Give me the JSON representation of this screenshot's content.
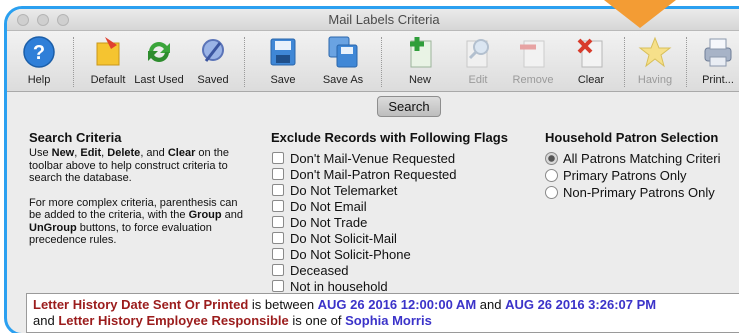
{
  "window": {
    "title": "Mail Labels Criteria"
  },
  "toolbar": {
    "help": "Help",
    "default": "Default",
    "last_used": "Last Used",
    "saved": "Saved",
    "save": "Save",
    "save_as": "Save As",
    "new": "New",
    "edit": "Edit",
    "remove": "Remove",
    "clear": "Clear",
    "having": "Having",
    "print": "Print..."
  },
  "search_button": "Search",
  "search_criteria": {
    "heading": "Search Criteria",
    "p1_a": "Use ",
    "p1_new": "New",
    "p1_b": ", ",
    "p1_edit": "Edit",
    "p1_c": ", ",
    "p1_delete": "Delete",
    "p1_d": ", and ",
    "p1_clear": "Clear",
    "p1_e": " on the toolbar above to help construct criteria to search the database.",
    "p2_a": "For more complex criteria, parenthesis can be added to the criteria, with the ",
    "p2_group": "Group",
    "p2_b": " and ",
    "p2_ungroup": "UnGroup",
    "p2_c": " buttons, to force evaluation precedence rules."
  },
  "exclude": {
    "heading": "Exclude Records with Following Flags",
    "flags": [
      "Don't Mail-Venue Requested",
      "Don't Mail-Patron Requested",
      "Do Not Telemarket",
      "Do Not Email",
      "Do Not Trade",
      "Do Not Solicit-Mail",
      "Do Not Solicit-Phone",
      "Deceased",
      "Not in household"
    ]
  },
  "household": {
    "heading": "Household Patron Selection",
    "options": [
      "All Patrons Matching Criteri",
      "Primary Patrons Only",
      "Non-Primary Patrons Only"
    ],
    "selected_index": 0
  },
  "criteria_expression": {
    "line1_field": "Letter History Date Sent Or Printed",
    "line1_op": " is between ",
    "line1_val1": "AUG 26 2016 12:00:00 AM",
    "line1_and": " and ",
    "line1_val2": "AUG 26 2016 3:26:07 PM",
    "line2_and": "and ",
    "line2_field": "Letter History Employee Responsible",
    "line2_op": " is one of ",
    "line2_val": "Sophia Morris"
  },
  "colors": {
    "window_border": "#2ba0f0",
    "highlight_arrow": "#f39c34",
    "field_text": "#9b1c1c",
    "value_text": "#3b33c9"
  }
}
